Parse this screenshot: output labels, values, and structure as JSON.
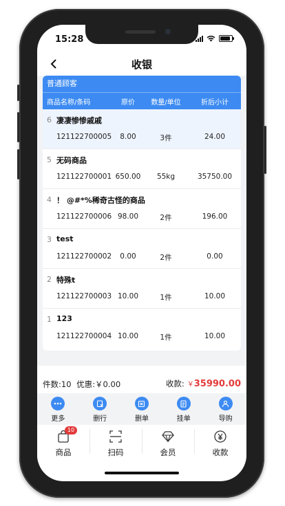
{
  "status": {
    "time": "15:28"
  },
  "nav": {
    "title": "收银"
  },
  "customer": "普通顾客",
  "columns": [
    "商品名称/条码",
    "原价",
    "数量/单位",
    "折后小计"
  ],
  "items": [
    {
      "index": "6",
      "name": "凄凄惨惨戚戚",
      "code": "121122700005",
      "price": "8.00",
      "qty": "3件",
      "subtotal": "24.00"
    },
    {
      "index": "5",
      "name": "无码商品",
      "code": "121122700001",
      "price": "650.00",
      "qty": "55kg",
      "subtotal": "35750.00"
    },
    {
      "index": "4",
      "name": "！ @#*%稀奇古怪的商品",
      "code": "121122700006",
      "price": "98.00",
      "qty": "2件",
      "subtotal": "196.00"
    },
    {
      "index": "3",
      "name": "test",
      "code": "121122700002",
      "price": "0.00",
      "qty": "2件",
      "subtotal": "0.00"
    },
    {
      "index": "2",
      "name": "特殊t",
      "code": "121122700003",
      "price": "10.00",
      "qty": "1件",
      "subtotal": "10.00"
    },
    {
      "index": "1",
      "name": "123",
      "code": "121122700004",
      "price": "10.00",
      "qty": "1件",
      "subtotal": "10.00"
    }
  ],
  "summary": {
    "count_text": "件数:10",
    "discount_text": "优惠:￥0.00",
    "total_label": "收款:",
    "currency": "￥",
    "total": "35990.00"
  },
  "actions": [
    {
      "label": "更多",
      "icon": "more-dots-icon"
    },
    {
      "label": "删行",
      "icon": "delete-row-icon"
    },
    {
      "label": "删单",
      "icon": "delete-order-icon"
    },
    {
      "label": "挂单",
      "icon": "hold-order-icon"
    },
    {
      "label": "导购",
      "icon": "guide-person-icon"
    }
  ],
  "tabs": [
    {
      "label": "商品",
      "icon": "shopping-bag-icon",
      "badge": "10"
    },
    {
      "label": "扫码",
      "icon": "scan-icon"
    },
    {
      "label": "会员",
      "icon": "diamond-icon"
    },
    {
      "label": "收款",
      "icon": "yen-coin-icon"
    }
  ],
  "colors": {
    "accent": "#3d8bf2",
    "total": "#e43c3c",
    "badge": "#e23b3b",
    "selected_row": "#eef4fd"
  }
}
